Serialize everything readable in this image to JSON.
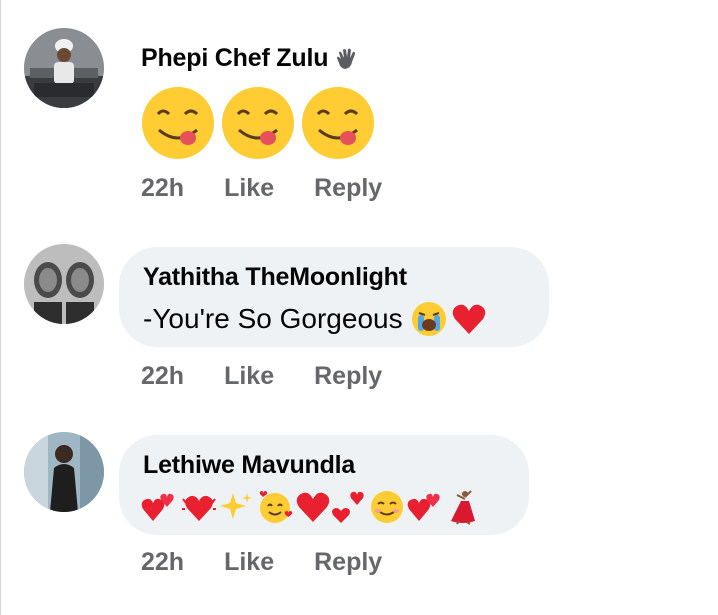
{
  "comments": [
    {
      "author": "Phepi Chef Zulu",
      "author_badge_icon": "wave-hand-icon",
      "content_emojis": [
        "yum-face",
        "yum-face",
        "yum-face"
      ],
      "time": "22h",
      "like_label": "Like",
      "reply_label": "Reply"
    },
    {
      "author": "Yathitha TheMoonlight",
      "text": "-You're So Gorgeous",
      "text_emojis": [
        "crying-face",
        "red-heart"
      ],
      "time": "22h",
      "like_label": "Like",
      "reply_label": "Reply"
    },
    {
      "author": "Lethiwe Mavundla",
      "text_emojis": [
        "two-hearts",
        "heart-vibrating",
        "sparkles",
        "smiling-face-with-hearts",
        "red-heart",
        "heart-exclamation",
        "smiling-face",
        "two-hearts",
        "dancer"
      ],
      "time": "22h",
      "like_label": "Like",
      "reply_label": "Reply"
    }
  ],
  "colors": {
    "bubble": "#eff2f5",
    "name": "#050505",
    "meta": "#65676b",
    "emoji_yellow": "#ffcc33",
    "heart_red": "#e8202f"
  }
}
